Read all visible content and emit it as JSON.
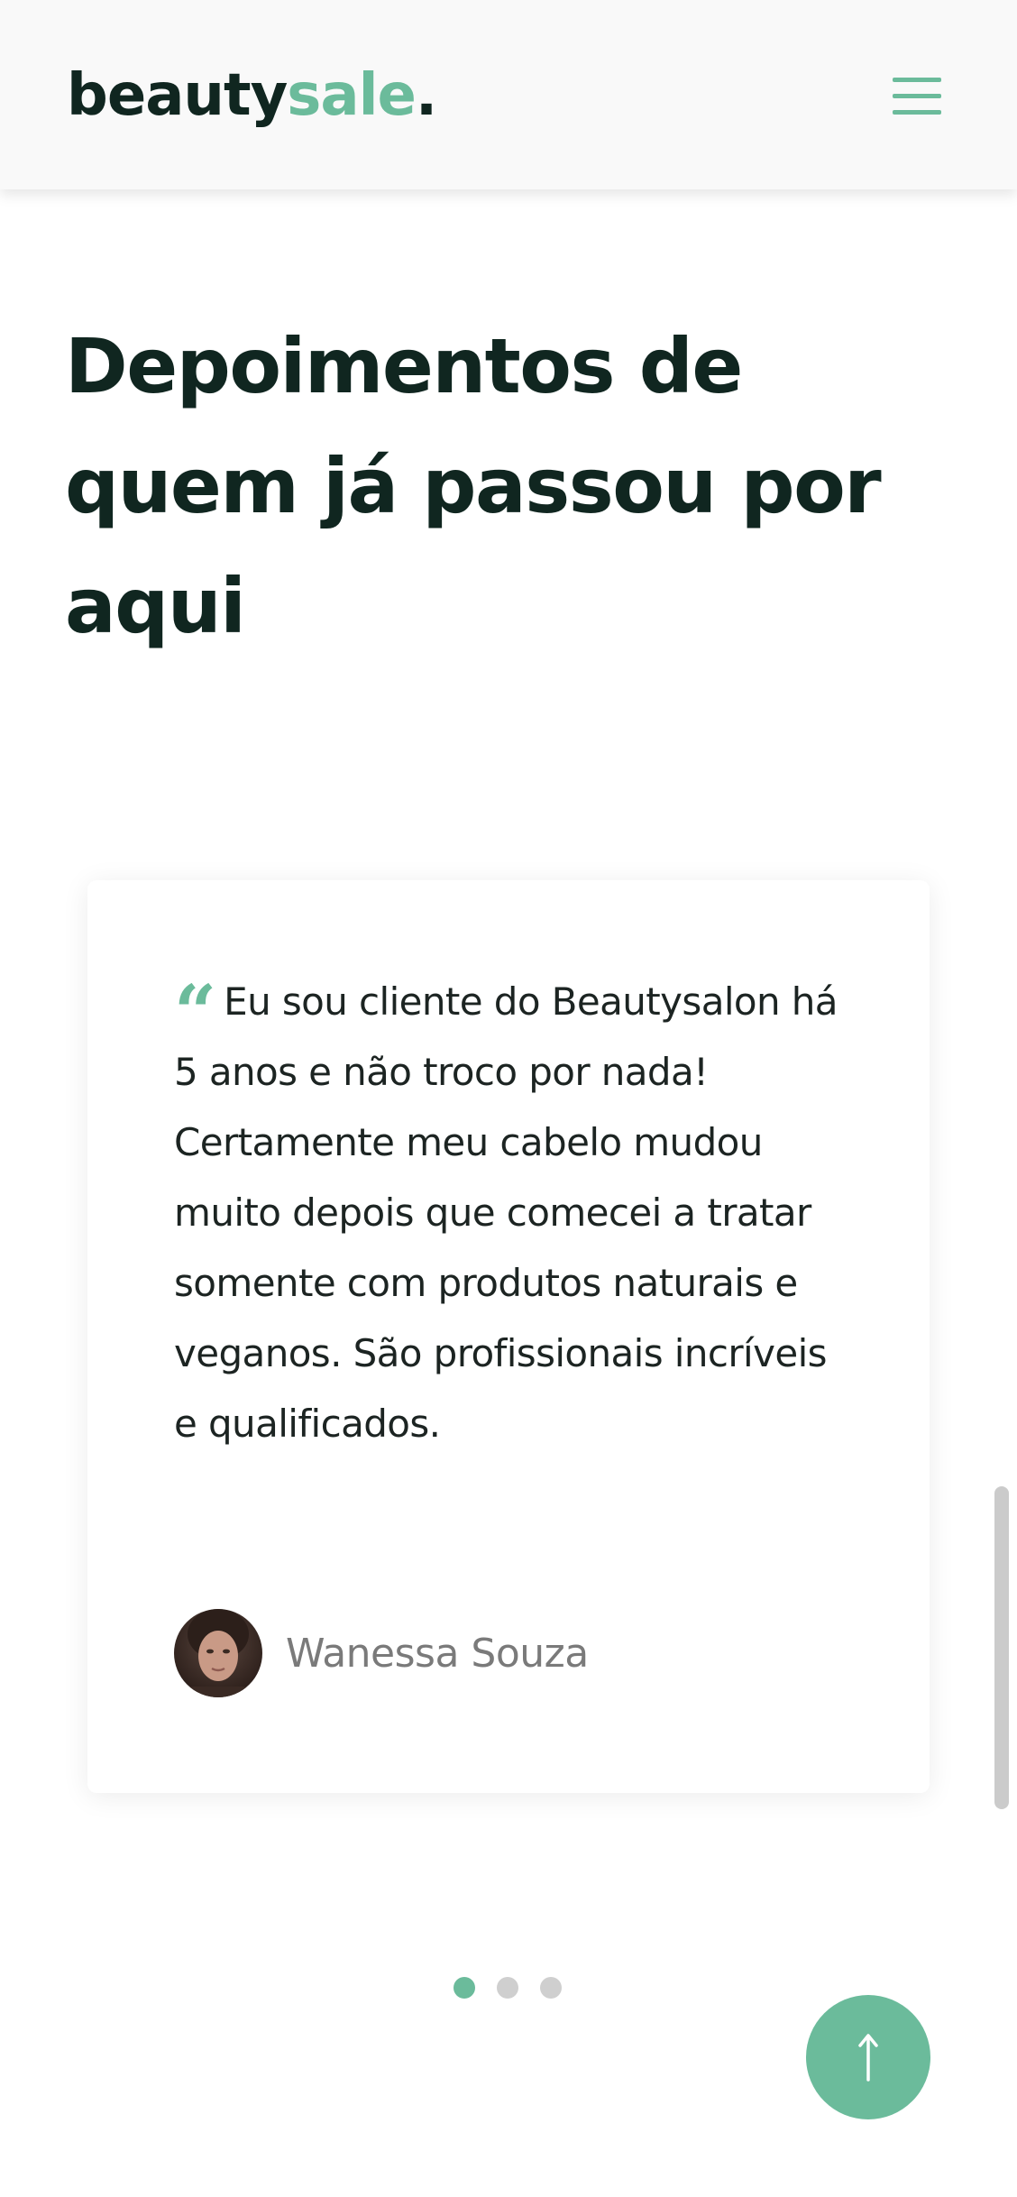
{
  "header": {
    "logo": {
      "part1": "beauty",
      "part2": "sale",
      "part3": "."
    },
    "menu_icon": "hamburger-menu-icon"
  },
  "section": {
    "title": "Depoimentos de quem já passou por aqui"
  },
  "testimonial": {
    "quote_icon": "quote-icon",
    "text": "Eu sou cliente do Beautysalon há 5 anos e não troco por nada! Certamente meu cabelo mudou muito depois que comecei a tratar somente com produtos naturais e veganos. São profissionais incríveis e qualificados.",
    "author": "Wanessa Souza"
  },
  "carousel": {
    "total_slides": 3,
    "active_slide": 1
  },
  "back_to_top": {
    "icon": "arrow-up-icon"
  },
  "colors": {
    "accent": "#6bbb9b",
    "dark": "#102620",
    "muted": "#7a7a7a"
  }
}
